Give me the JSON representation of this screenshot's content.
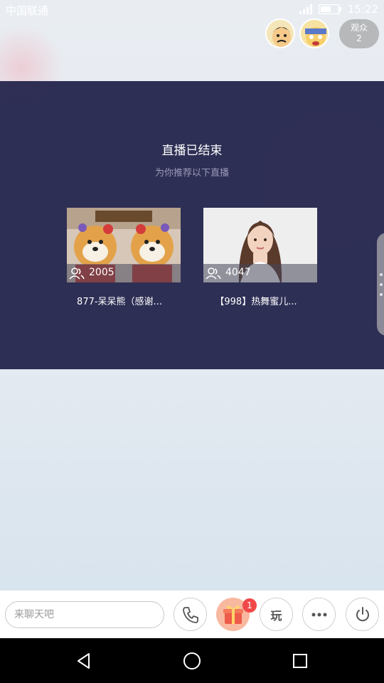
{
  "status_bar": {
    "carrier": "中国联通",
    "time": "15:22"
  },
  "viewers": {
    "label": "观众",
    "count": "2"
  },
  "ended": {
    "title": "直播已结束",
    "subtitle": "为你推荐以下直播"
  },
  "recommendations": [
    {
      "viewers": "2005",
      "title": "877-呆呆熊（感谢..."
    },
    {
      "viewers": "4047",
      "title": "【998】热舞蜜儿..."
    }
  ],
  "chat": {
    "placeholder": "来聊天吧"
  },
  "toolbar": {
    "play_label": "玩",
    "gift_badge": "1"
  },
  "colors": {
    "panel": "#26264e",
    "accent_gift": "#f9b9a0",
    "badge": "#f04848"
  },
  "icons": [
    "signal-icon",
    "battery-icon",
    "people-icon",
    "phone-icon",
    "gift-icon",
    "more-icon",
    "power-icon",
    "back-icon",
    "home-icon",
    "recent-apps-icon"
  ]
}
